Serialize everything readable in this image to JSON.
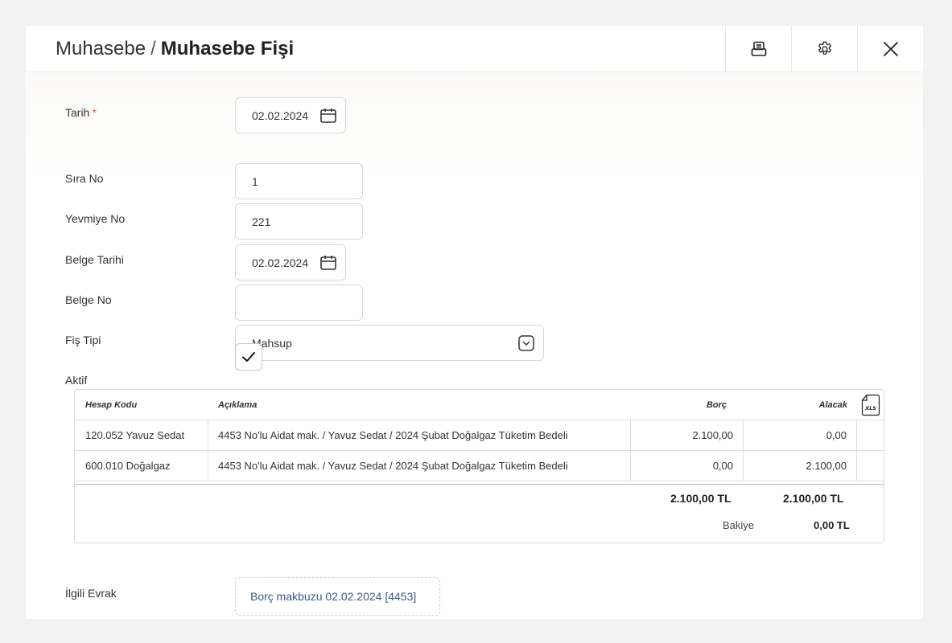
{
  "header": {
    "breadcrumb_parent": "Muhasebe",
    "separator": "/",
    "page_title": "Muhasebe Fişi",
    "print_icon": "printer-icon",
    "settings_icon": "gear-icon",
    "close_icon": "close-icon"
  },
  "form": {
    "tarih": {
      "label": "Tarih",
      "required_mark": "*",
      "value": "02.02.2024"
    },
    "sira_no": {
      "label": "Sıra No",
      "value": "1"
    },
    "yevmiye_no": {
      "label": "Yevmiye No",
      "value": "221"
    },
    "belge_tarihi": {
      "label": "Belge Tarihi",
      "value": "02.02.2024"
    },
    "belge_no": {
      "label": "Belge No",
      "value": ""
    },
    "fis_tipi": {
      "label": "Fiş Tipi",
      "value": "Mahsup"
    },
    "aktif": {
      "label": "Aktif",
      "checked": true
    }
  },
  "table": {
    "columns": [
      "Hesap Kodu",
      "Açıklama",
      "Borç",
      "Alacak"
    ],
    "export_icon": "xls-file-icon",
    "export_label": "XLS",
    "rows": [
      {
        "hesap": "120.052 Yavuz Sedat",
        "aciklama": "4453 No'lu Aidat mak. / Yavuz Sedat / 2024 Şubat Doğalgaz Tüketim Bedeli",
        "borc": "2.100,00",
        "alacak": "0,00"
      },
      {
        "hesap": "600.010 Doğalgaz",
        "aciklama": "4453 No'lu Aidat mak. / Yavuz Sedat / 2024 Şubat Doğalgaz Tüketim Bedeli",
        "borc": "0,00",
        "alacak": "2.100,00"
      }
    ],
    "total_borc": "2.100,00 TL",
    "total_alacak": "2.100,00 TL",
    "bakiye_label": "Bakiye",
    "bakiye_value": "0,00 TL"
  },
  "related": {
    "label": "İlgili Evrak",
    "link": "Borç makbuzu 02.02.2024 [4453]"
  }
}
